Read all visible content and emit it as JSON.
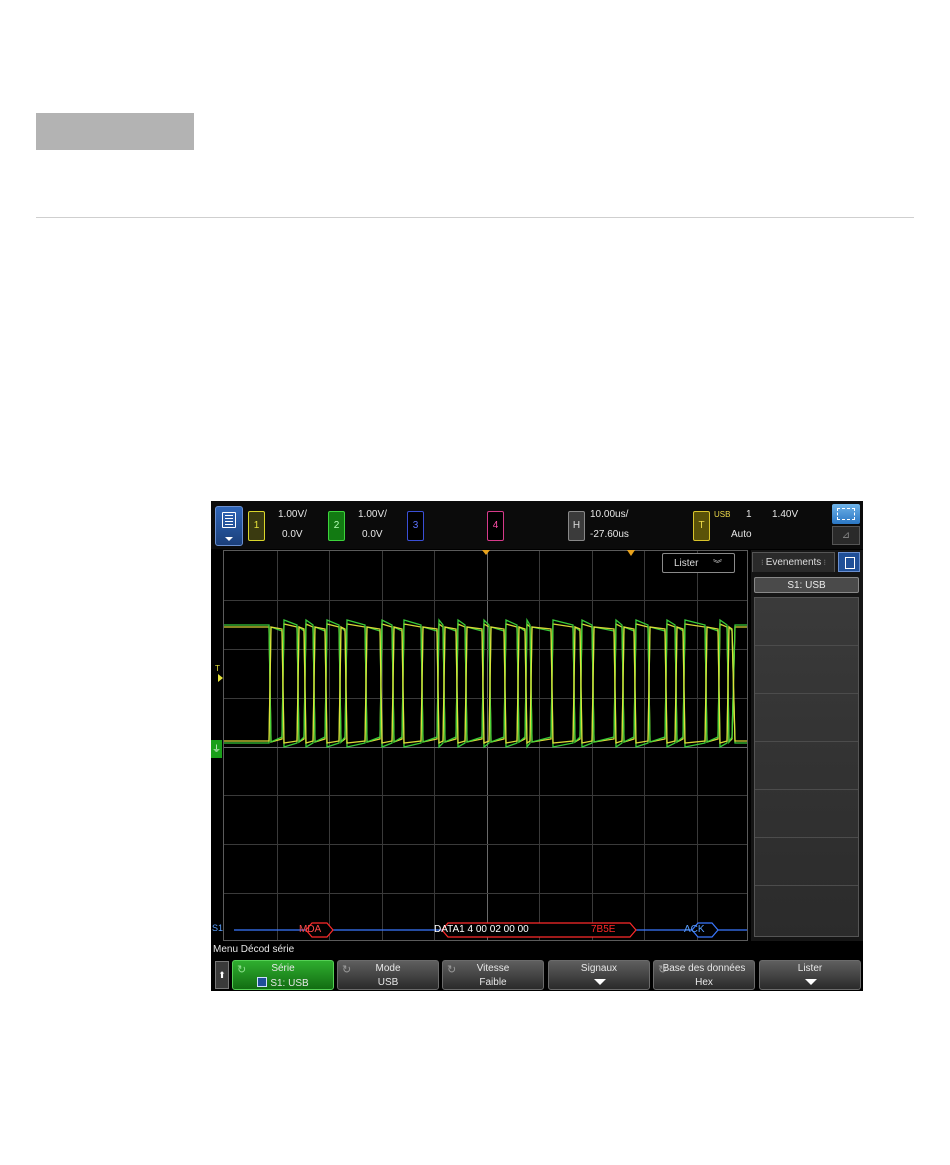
{
  "scope": {
    "top_bar": {
      "ch1": {
        "label": "1",
        "scale": "1.00V/",
        "offset": "0.0V"
      },
      "ch2": {
        "label": "2",
        "scale": "1.00V/",
        "offset": "0.0V"
      },
      "ch3": {
        "label": "3"
      },
      "ch4": {
        "label": "4"
      },
      "horizontal": {
        "label": "H",
        "scale": "10.00us/",
        "delay": "-27.60us"
      },
      "trigger": {
        "label": "T",
        "source": "USB",
        "channel": "1",
        "level": "1.40V",
        "mode": "Auto"
      }
    },
    "plot": {
      "lister_label": "Lister",
      "level_t_label": "T",
      "ground_label": "⏚",
      "serial_label": "S1"
    },
    "decode": {
      "packets": [
        "MDA",
        "DATA1  4  00  02  00  00",
        "7B5E",
        "ACK"
      ]
    },
    "events_panel": {
      "tab_label": "Evenements",
      "header": "S1: USB"
    },
    "menu": {
      "title": "Menu Décod série",
      "softkeys": [
        {
          "line1": "Série",
          "line2": "S1: USB"
        },
        {
          "line1": "Mode",
          "line2": "USB"
        },
        {
          "line1": "Vitesse",
          "line2": "Faible"
        },
        {
          "line1": "Signaux",
          "line2": ""
        },
        {
          "line1": "Base des données",
          "line2": "Hex"
        },
        {
          "line1": "Lister",
          "line2": ""
        }
      ]
    },
    "colors": {
      "ch1": "#e6e33a",
      "ch2": "#3bd43b",
      "decode_bus": "#3a78ff",
      "decode_error": "#ff2a2a"
    }
  }
}
